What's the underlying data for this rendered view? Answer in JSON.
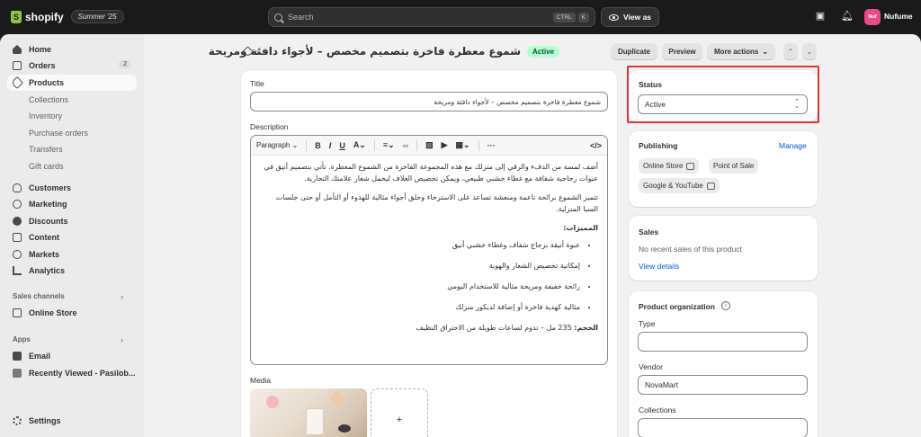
{
  "topbar": {
    "logo_text": "shopify",
    "edition": "Summer '25",
    "search_placeholder": "Search",
    "kbd_ctrl": "CTRL",
    "kbd_k": "K",
    "view_as": "View as",
    "avatar_initials": "Nuf",
    "user_name": "Nufume"
  },
  "sidebar": {
    "items": [
      {
        "label": "Home"
      },
      {
        "label": "Orders",
        "count": "2"
      },
      {
        "label": "Products"
      },
      {
        "label": "Collections"
      },
      {
        "label": "Inventory"
      },
      {
        "label": "Purchase orders"
      },
      {
        "label": "Transfers"
      },
      {
        "label": "Gift cards"
      },
      {
        "label": "Customers"
      },
      {
        "label": "Marketing"
      },
      {
        "label": "Discounts"
      },
      {
        "label": "Content"
      },
      {
        "label": "Markets"
      },
      {
        "label": "Analytics"
      }
    ],
    "sales_channels_label": "Sales channels",
    "online_store": "Online Store",
    "apps_label": "Apps",
    "email": "Email",
    "recently_viewed": "Recently Viewed - Pasilob...",
    "settings": "Settings"
  },
  "header": {
    "title": "شموع معطرة فاخرة بتصميم مخصص – لأجواء دافئة ومريحة",
    "status_badge": "Active",
    "duplicate": "Duplicate",
    "preview": "Preview",
    "more_actions": "More actions"
  },
  "main": {
    "title_label": "Title",
    "title_value": "شموع معطرة فاخرة بتصميم مخصص – لأجواء دافئة ومريحة",
    "description_label": "Description",
    "toolbar_paragraph": "Paragraph",
    "desc_p1": "أضف لمسة من الدفء والرقي إلى منزلك مع هذه المجموعة الفاخرة من الشموع المعطرة. تأتي بتصميم أنيق في عبوات زجاجية شفافة مع غطاء خشبي طبيعي، ويمكن تخصيص الغلاف ليحمل شعار علامتك التجارية.",
    "desc_p2": "تتميز الشموع برائحة ناعمة ومنعشة تساعد على الاسترخاء وخلق أجواء مثالية للهدوء أو التأمل أو حتى جلسات السبا المنزلية.",
    "features_heading": "المميزات:",
    "features": [
      "عبوة أنيقة بزجاج شفاف وغطاء خشبي أنيق",
      "إمكانية تخصيص الشعار والهوية",
      "رائحة خفيفة ومريحة مثالية للاستخدام اليومي",
      "مثالية كهدية فاخرة أو إضافة لديكور منزلك"
    ],
    "size_label": "الحجم:",
    "size_text": "235 مل – تدوم لساعات طويلة من الاحتراق النظيف",
    "media_label": "Media",
    "media_add": "+"
  },
  "right": {
    "status_label": "Status",
    "status_value": "Active",
    "publishing_label": "Publishing",
    "manage": "Manage",
    "channels": [
      "Online Store",
      "Point of Sale",
      "Google & YouTube"
    ],
    "sales_label": "Sales",
    "sales_empty": "No recent sales of this product",
    "view_details": "View details",
    "org_label": "Product organization",
    "type_label": "Type",
    "type_value": "",
    "vendor_label": "Vendor",
    "vendor_value": "NovaMart",
    "collections_label": "Collections"
  }
}
